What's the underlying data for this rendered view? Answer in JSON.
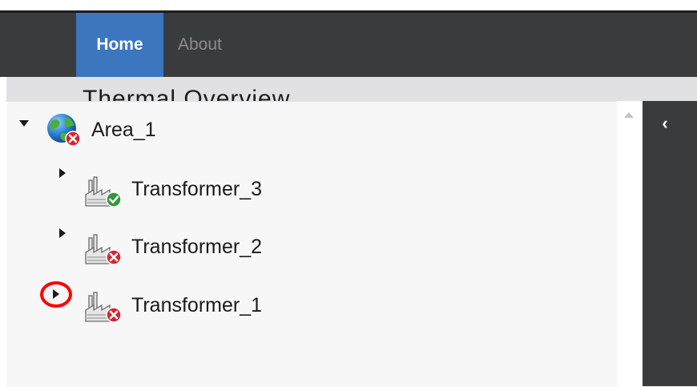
{
  "nav": {
    "tabs": [
      {
        "label": "Home",
        "active": true
      },
      {
        "label": "About",
        "active": false
      }
    ]
  },
  "heading": {
    "text": "Thermal Overview"
  },
  "side_panel": {
    "collapse_glyph": "‹"
  },
  "tree": {
    "root": {
      "label": "Area_1",
      "expanded": true,
      "icon": "globe-icon",
      "status": "error"
    },
    "children": [
      {
        "label": "Transformer_3",
        "expanded": false,
        "icon": "factory-icon",
        "status": "ok"
      },
      {
        "label": "Transformer_2",
        "expanded": false,
        "icon": "factory-icon",
        "status": "error"
      },
      {
        "label": "Transformer_1",
        "expanded": false,
        "icon": "factory-icon",
        "status": "error",
        "highlighted": true
      }
    ]
  },
  "colors": {
    "nav_bg": "#3a3b3d",
    "active_tab": "#3b76bf",
    "status_ok": "#2e9a3a",
    "status_error": "#d9232e",
    "highlight": "#ff0000"
  }
}
